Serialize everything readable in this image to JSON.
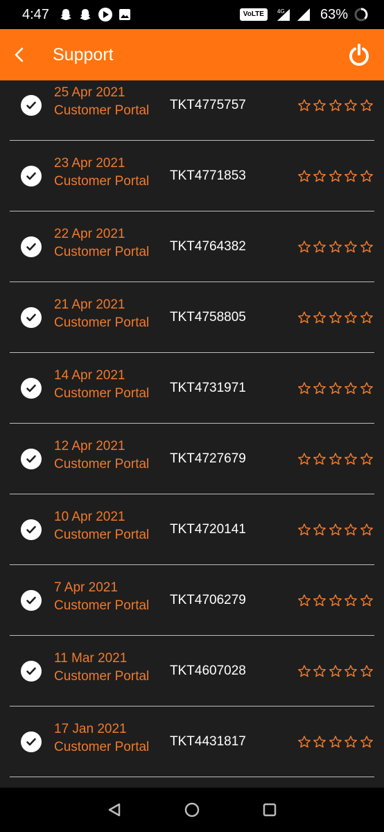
{
  "status_bar": {
    "time": "4:47",
    "network": "VoLTE",
    "signal_type": "4G",
    "battery": "63%"
  },
  "app_bar": {
    "title": "Support"
  },
  "tickets": [
    {
      "date": "25 Apr 2021",
      "source": "Customer Portal",
      "ticket_id": "TKT4775757",
      "rating": 0
    },
    {
      "date": "23 Apr 2021",
      "source": "Customer Portal",
      "ticket_id": "TKT4771853",
      "rating": 0
    },
    {
      "date": "22 Apr 2021",
      "source": "Customer Portal",
      "ticket_id": "TKT4764382",
      "rating": 0
    },
    {
      "date": "21 Apr 2021",
      "source": "Customer Portal",
      "ticket_id": "TKT4758805",
      "rating": 0
    },
    {
      "date": "14 Apr 2021",
      "source": "Customer Portal",
      "ticket_id": "TKT4731971",
      "rating": 0
    },
    {
      "date": "12 Apr 2021",
      "source": "Customer Portal",
      "ticket_id": "TKT4727679",
      "rating": 0
    },
    {
      "date": "10 Apr 2021",
      "source": "Customer Portal",
      "ticket_id": "TKT4720141",
      "rating": 0
    },
    {
      "date": "7 Apr 2021",
      "source": "Customer Portal",
      "ticket_id": "TKT4706279",
      "rating": 0
    },
    {
      "date": "11 Mar 2021",
      "source": "Customer Portal",
      "ticket_id": "TKT4607028",
      "rating": 0
    },
    {
      "date": "17 Jan 2021",
      "source": "Customer Portal",
      "ticket_id": "TKT4431817",
      "rating": 0
    }
  ],
  "colors": {
    "accent": "#ff7410",
    "date_text": "#f07a2c",
    "background": "#1e1e1e"
  }
}
